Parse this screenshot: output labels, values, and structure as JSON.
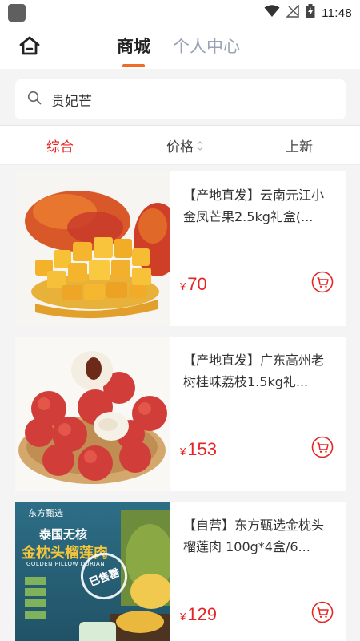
{
  "status_bar": {
    "time": "11:48",
    "icons": [
      "wifi-icon",
      "no-signal-icon",
      "battery-charging-icon"
    ]
  },
  "header": {
    "tabs": [
      {
        "label": "商城",
        "active": true
      },
      {
        "label": "个人中心",
        "active": false
      }
    ],
    "accent_color": "#f06a2a"
  },
  "search": {
    "value": "贵妃芒"
  },
  "sort_bar": {
    "items": [
      {
        "label": "综合",
        "active": true
      },
      {
        "label": "价格",
        "active": false
      },
      {
        "label": "上新",
        "active": false
      }
    ],
    "active_color": "#e52525"
  },
  "products": [
    {
      "title": "【产地直发】云南元江小金凤芒果2.5kg礼盒(...",
      "currency": "¥",
      "price": "70",
      "image": "mango-image"
    },
    {
      "title": "【产地直发】广东高州老树桂味荔枝1.5kg礼...",
      "currency": "¥",
      "price": "153",
      "image": "lychee-image"
    },
    {
      "title": "【自营】东方甄选金枕头榴莲肉 100g*4盒/6...",
      "currency": "¥",
      "price": "129",
      "image": "durian-image"
    }
  ],
  "durian_image_text": {
    "brand": "东方甄选",
    "headline_1": "泰国无核",
    "headline_2": "金枕头榴莲肉",
    "english": "GOLDEN PILLOW DURIAN",
    "badge": "已售罄"
  }
}
